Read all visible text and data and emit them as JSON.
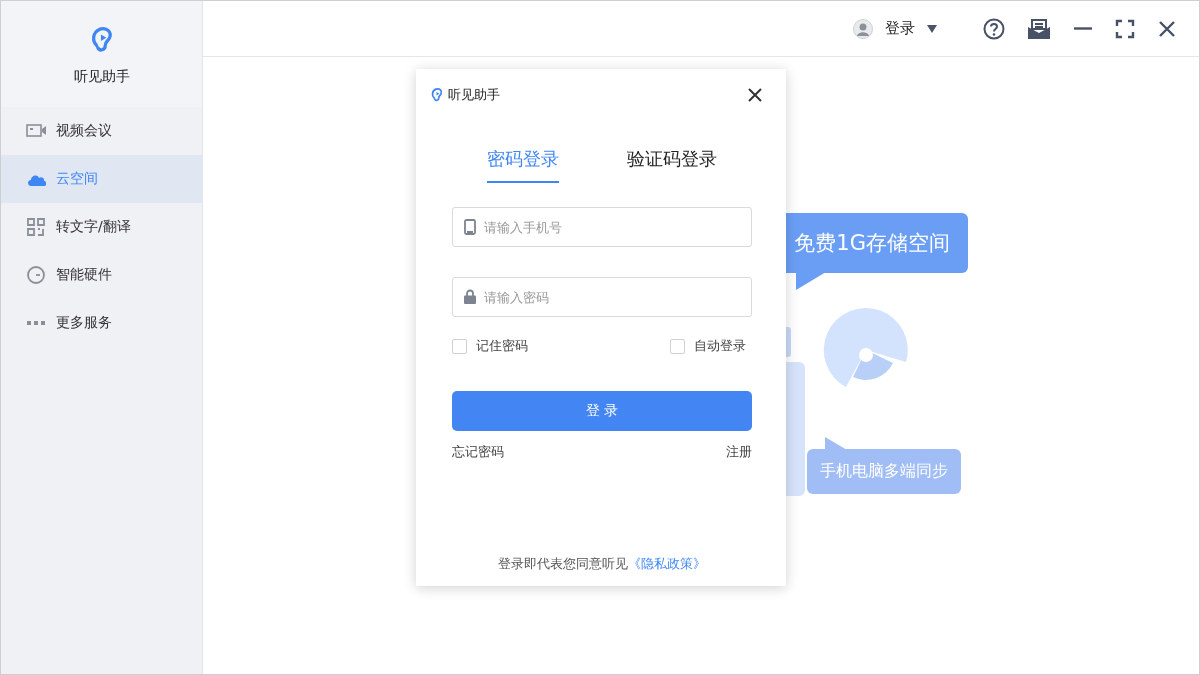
{
  "app": {
    "name": "听见助手"
  },
  "sidebar": {
    "items": [
      {
        "label": "视频会议",
        "selected": false
      },
      {
        "label": "云空间",
        "selected": true
      },
      {
        "label": "转文字/翻译",
        "selected": false
      },
      {
        "label": "智能硬件",
        "selected": false
      },
      {
        "label": "更多服务",
        "selected": false
      }
    ]
  },
  "topbar": {
    "account": "登录"
  },
  "promo": {
    "bubbles": [
      "免费1G存储空间",
      "手机电脑多端同步"
    ]
  },
  "dialog": {
    "title": "听见助手",
    "tabs": [
      {
        "label": "密码登录",
        "selected": true
      },
      {
        "label": "验证码登录",
        "selected": false
      }
    ],
    "phone_field": {
      "placeholder": "请输入手机号"
    },
    "password_field": {
      "placeholder": "请输入密码"
    },
    "options": [
      {
        "label": "记住密码",
        "checked": false
      },
      {
        "label": "自动登录",
        "checked": false
      }
    ],
    "login_button": "登 录",
    "forgot_link": "忘记密码",
    "register_link": "注册",
    "agreement": "登录即代表您同意听见",
    "privacy_link": "《隐私政策》"
  }
}
